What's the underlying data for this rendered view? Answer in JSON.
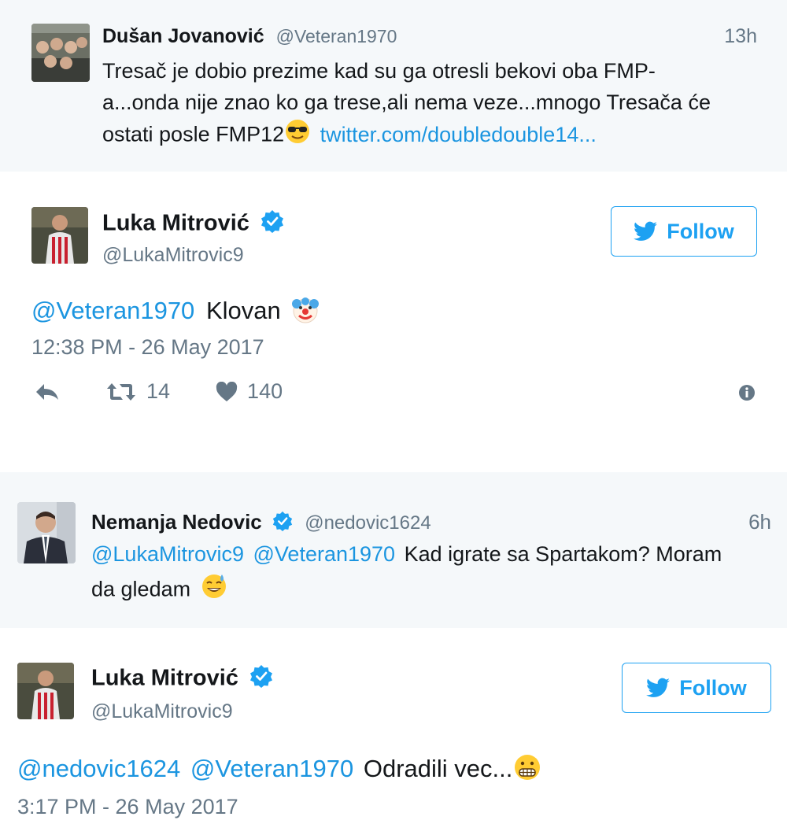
{
  "tweet1": {
    "name": "Dušan Jovanović",
    "handle": "@Veteran1970",
    "time": "13h",
    "line1": "Tresač je dobio prezime kad su ga otresli bekovi oba FMP-",
    "line2": "a...onda nije znao ko ga trese,ali nema veze...mnogo Tresača će",
    "line3_text": "ostati posle FMP12",
    "line3_link": "twitter.com/doubledouble14..."
  },
  "tweet2": {
    "name": "Luka Mitrović",
    "handle": "@LukaMitrovic9",
    "follow_label": "Follow",
    "mention": "@Veteran1970",
    "text": "Klovan",
    "timestamp": "12:38 PM - 26 May 2017",
    "retweets": "14",
    "likes": "140"
  },
  "tweet3": {
    "name": "Nemanja Nedovic",
    "handle": "@nedovic1624",
    "time": "6h",
    "mention1": "@LukaMitrovic9",
    "mention2": "@Veteran1970",
    "text1": "Kad igrate sa Spartakom? Moram",
    "text2": "da gledam"
  },
  "tweet4": {
    "name": "Luka Mitrović",
    "handle": "@LukaMitrovic9",
    "follow_label": "Follow",
    "mention1": "@nedovic1624",
    "mention2": "@Veteran1970",
    "text": "Odradili vec...",
    "timestamp": "3:17 PM - 26 May 2017"
  },
  "colors": {
    "link": "#1b95e0",
    "follow": "#1da1f2",
    "reply_bg": "#f5f8fa",
    "muted": "#657786"
  }
}
